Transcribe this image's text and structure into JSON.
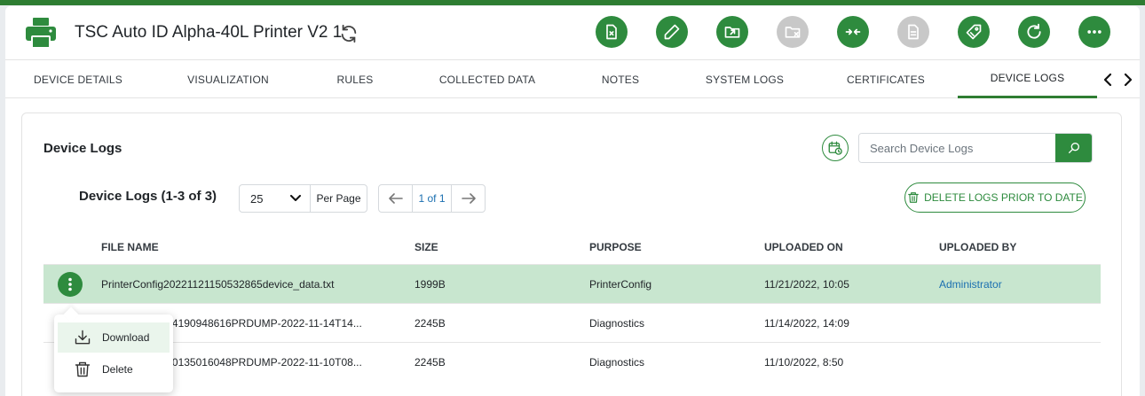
{
  "header": {
    "title": "TSC Auto ID Alpha-40L Printer V2 1",
    "brand_color": "#2e8b3e",
    "actions": [
      {
        "name": "remove-device-button",
        "icon": "file-x-icon",
        "disabled": false
      },
      {
        "name": "edit-button",
        "icon": "pencil-icon",
        "disabled": false
      },
      {
        "name": "export-button",
        "icon": "folder-export-icon",
        "disabled": false
      },
      {
        "name": "remove-folder-button",
        "icon": "folder-x-icon",
        "disabled": true
      },
      {
        "name": "transfer-button",
        "icon": "arrows-in-icon",
        "disabled": false
      },
      {
        "name": "document-button",
        "icon": "document-icon",
        "disabled": true
      },
      {
        "name": "tag-button",
        "icon": "tag-icon",
        "disabled": false
      },
      {
        "name": "refresh-button",
        "icon": "refresh-icon",
        "disabled": false
      },
      {
        "name": "more-button",
        "icon": "more-horizontal-icon",
        "disabled": false
      }
    ]
  },
  "tabs": [
    {
      "label": "DEVICE DETAILS",
      "active": false
    },
    {
      "label": "VISUALIZATION",
      "active": false
    },
    {
      "label": "RULES",
      "active": false
    },
    {
      "label": "COLLECTED DATA",
      "active": false
    },
    {
      "label": "NOTES",
      "active": false
    },
    {
      "label": "SYSTEM LOGS",
      "active": false
    },
    {
      "label": "CERTIFICATES",
      "active": false
    },
    {
      "label": "DEVICE LOGS",
      "active": true
    }
  ],
  "card": {
    "title": "Device Logs",
    "search_placeholder": "Search Device Logs",
    "count_label": "Device Logs (1-3 of 3)",
    "page_size": "25",
    "per_page_label": "Per Page",
    "page_info": "1 of 1",
    "delete_prior_label": "DELETE LOGS PRIOR TO DATE"
  },
  "table": {
    "columns": [
      "FILE NAME",
      "SIZE",
      "PURPOSE",
      "UPLOADED ON",
      "UPLOADED BY"
    ],
    "rows": [
      {
        "file": "PrinterConfig20221121150532865device_data.txt",
        "size": "1999B",
        "purpose": "PrinterConfig",
        "uploaded_on": "11/21/2022, 10:05",
        "uploaded_by": "Administrator"
      },
      {
        "file": "21114190948616PRDUMP-2022-11-14T14...",
        "size": "2245B",
        "purpose": "Diagnostics",
        "uploaded_on": "11/14/2022, 14:09",
        "uploaded_by": ""
      },
      {
        "file": "21110135016048PRDUMP-2022-11-10T08...",
        "size": "2245B",
        "purpose": "Diagnostics",
        "uploaded_on": "11/10/2022, 8:50",
        "uploaded_by": ""
      }
    ]
  },
  "row_menu": {
    "download_label": "Download",
    "delete_label": "Delete"
  }
}
